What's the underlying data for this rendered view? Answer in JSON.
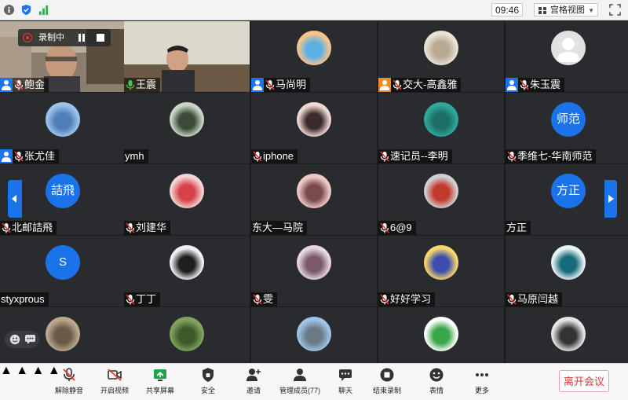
{
  "top_bar": {
    "time": "09:46",
    "view_mode": "宫格视图"
  },
  "recording": {
    "label": "录制中"
  },
  "participants": [
    {
      "name": "鲍金",
      "avatar_type": "camera",
      "host": "blue",
      "mic": "muted"
    },
    {
      "name": "王震",
      "avatar_type": "camera",
      "host": "",
      "mic": "active"
    },
    {
      "name": "马尚明",
      "avatar_type": "image",
      "host": "blue",
      "mic": "muted",
      "colors": [
        "#f6c48a",
        "#5bb1e6"
      ]
    },
    {
      "name": "交大-高鑫雅",
      "avatar_type": "image",
      "host": "orange",
      "mic": "muted",
      "colors": [
        "#e9e2d6",
        "#b9a991"
      ]
    },
    {
      "name": "朱玉震",
      "avatar_type": "default",
      "host": "blue",
      "mic": "muted"
    },
    {
      "name": "张尤佳",
      "avatar_type": "image",
      "host": "blue",
      "mic": "muted",
      "colors": [
        "#9bc3ea",
        "#4d7fb8"
      ]
    },
    {
      "name": "ymh",
      "avatar_type": "image",
      "host": "",
      "mic": "none",
      "colors": [
        "#c9d6c4",
        "#3c4a3a"
      ]
    },
    {
      "name": "iphone",
      "avatar_type": "image",
      "host": "",
      "mic": "muted",
      "colors": [
        "#f1d9d3",
        "#3b2b2b"
      ]
    },
    {
      "name": "速记员--李明",
      "avatar_type": "image",
      "host": "",
      "mic": "muted",
      "colors": [
        "#2fa89b",
        "#1c6f67"
      ]
    },
    {
      "name": "季维七-华南师范",
      "avatar_type": "text",
      "avatar_text": "师范",
      "host": "",
      "mic": "muted"
    },
    {
      "name": "北邮詰飛",
      "avatar_type": "text",
      "avatar_text": "詰飛",
      "host": "",
      "mic": "muted"
    },
    {
      "name": "刘建华",
      "avatar_type": "image",
      "host": "",
      "mic": "muted",
      "colors": [
        "#f3d3d3",
        "#d9414a"
      ]
    },
    {
      "name": "东大—马院",
      "avatar_type": "image",
      "host": "",
      "mic": "none",
      "colors": [
        "#f0c9c9",
        "#7a4b4b"
      ]
    },
    {
      "name": "6@9",
      "avatar_type": "image",
      "host": "",
      "mic": "muted",
      "colors": [
        "#cfcfcf",
        "#c23a2e"
      ]
    },
    {
      "name": "方正",
      "avatar_type": "text",
      "avatar_text": "方正",
      "host": "",
      "mic": "none"
    },
    {
      "name": "styxprous",
      "avatar_type": "text",
      "avatar_text": "S",
      "host": "",
      "mic": "none"
    },
    {
      "name": "丁丁",
      "avatar_type": "image",
      "host": "",
      "mic": "muted",
      "colors": [
        "#f2f2f2",
        "#1e1e1e"
      ]
    },
    {
      "name": "雯",
      "avatar_type": "image",
      "host": "",
      "mic": "muted",
      "colors": [
        "#e8d6e0",
        "#7a5a6a"
      ]
    },
    {
      "name": "好好学习",
      "avatar_type": "image",
      "host": "",
      "mic": "muted",
      "colors": [
        "#f7d66a",
        "#3d4fae"
      ]
    },
    {
      "name": "马原闫越",
      "avatar_type": "image",
      "host": "",
      "mic": "muted",
      "colors": [
        "#e9f3f5",
        "#166b7a"
      ]
    },
    {
      "name": "",
      "avatar_type": "image",
      "host": "",
      "mic": "none",
      "colors": [
        "#bba88f",
        "#6a5a46"
      ]
    },
    {
      "name": "",
      "avatar_type": "image",
      "host": "",
      "mic": "none",
      "colors": [
        "#7fa35f",
        "#3d5a28"
      ]
    },
    {
      "name": "",
      "avatar_type": "image",
      "host": "",
      "mic": "none",
      "colors": [
        "#9ec4e8",
        "#6b7b86"
      ]
    },
    {
      "name": "",
      "avatar_type": "image",
      "host": "",
      "mic": "none",
      "colors": [
        "#ffffff",
        "#3aa64a"
      ]
    },
    {
      "name": "",
      "avatar_type": "image",
      "host": "",
      "mic": "none",
      "colors": [
        "#e6e6e6",
        "#333333"
      ]
    }
  ],
  "toolbar": {
    "unmute": "解除静音",
    "start_video": "开启视频",
    "share_screen": "共享屏幕",
    "security": "安全",
    "invite": "邀请",
    "manage_members": "管理成员(77)",
    "chat": "聊天",
    "stop_recording": "结束录制",
    "reactions": "表情",
    "more": "更多",
    "leave": "离开会议"
  },
  "colors": {
    "accent": "#1a73e8",
    "danger": "#d63b3b",
    "grid_bg": "#1b1c1e",
    "tile_bg": "#2a2b2e"
  }
}
